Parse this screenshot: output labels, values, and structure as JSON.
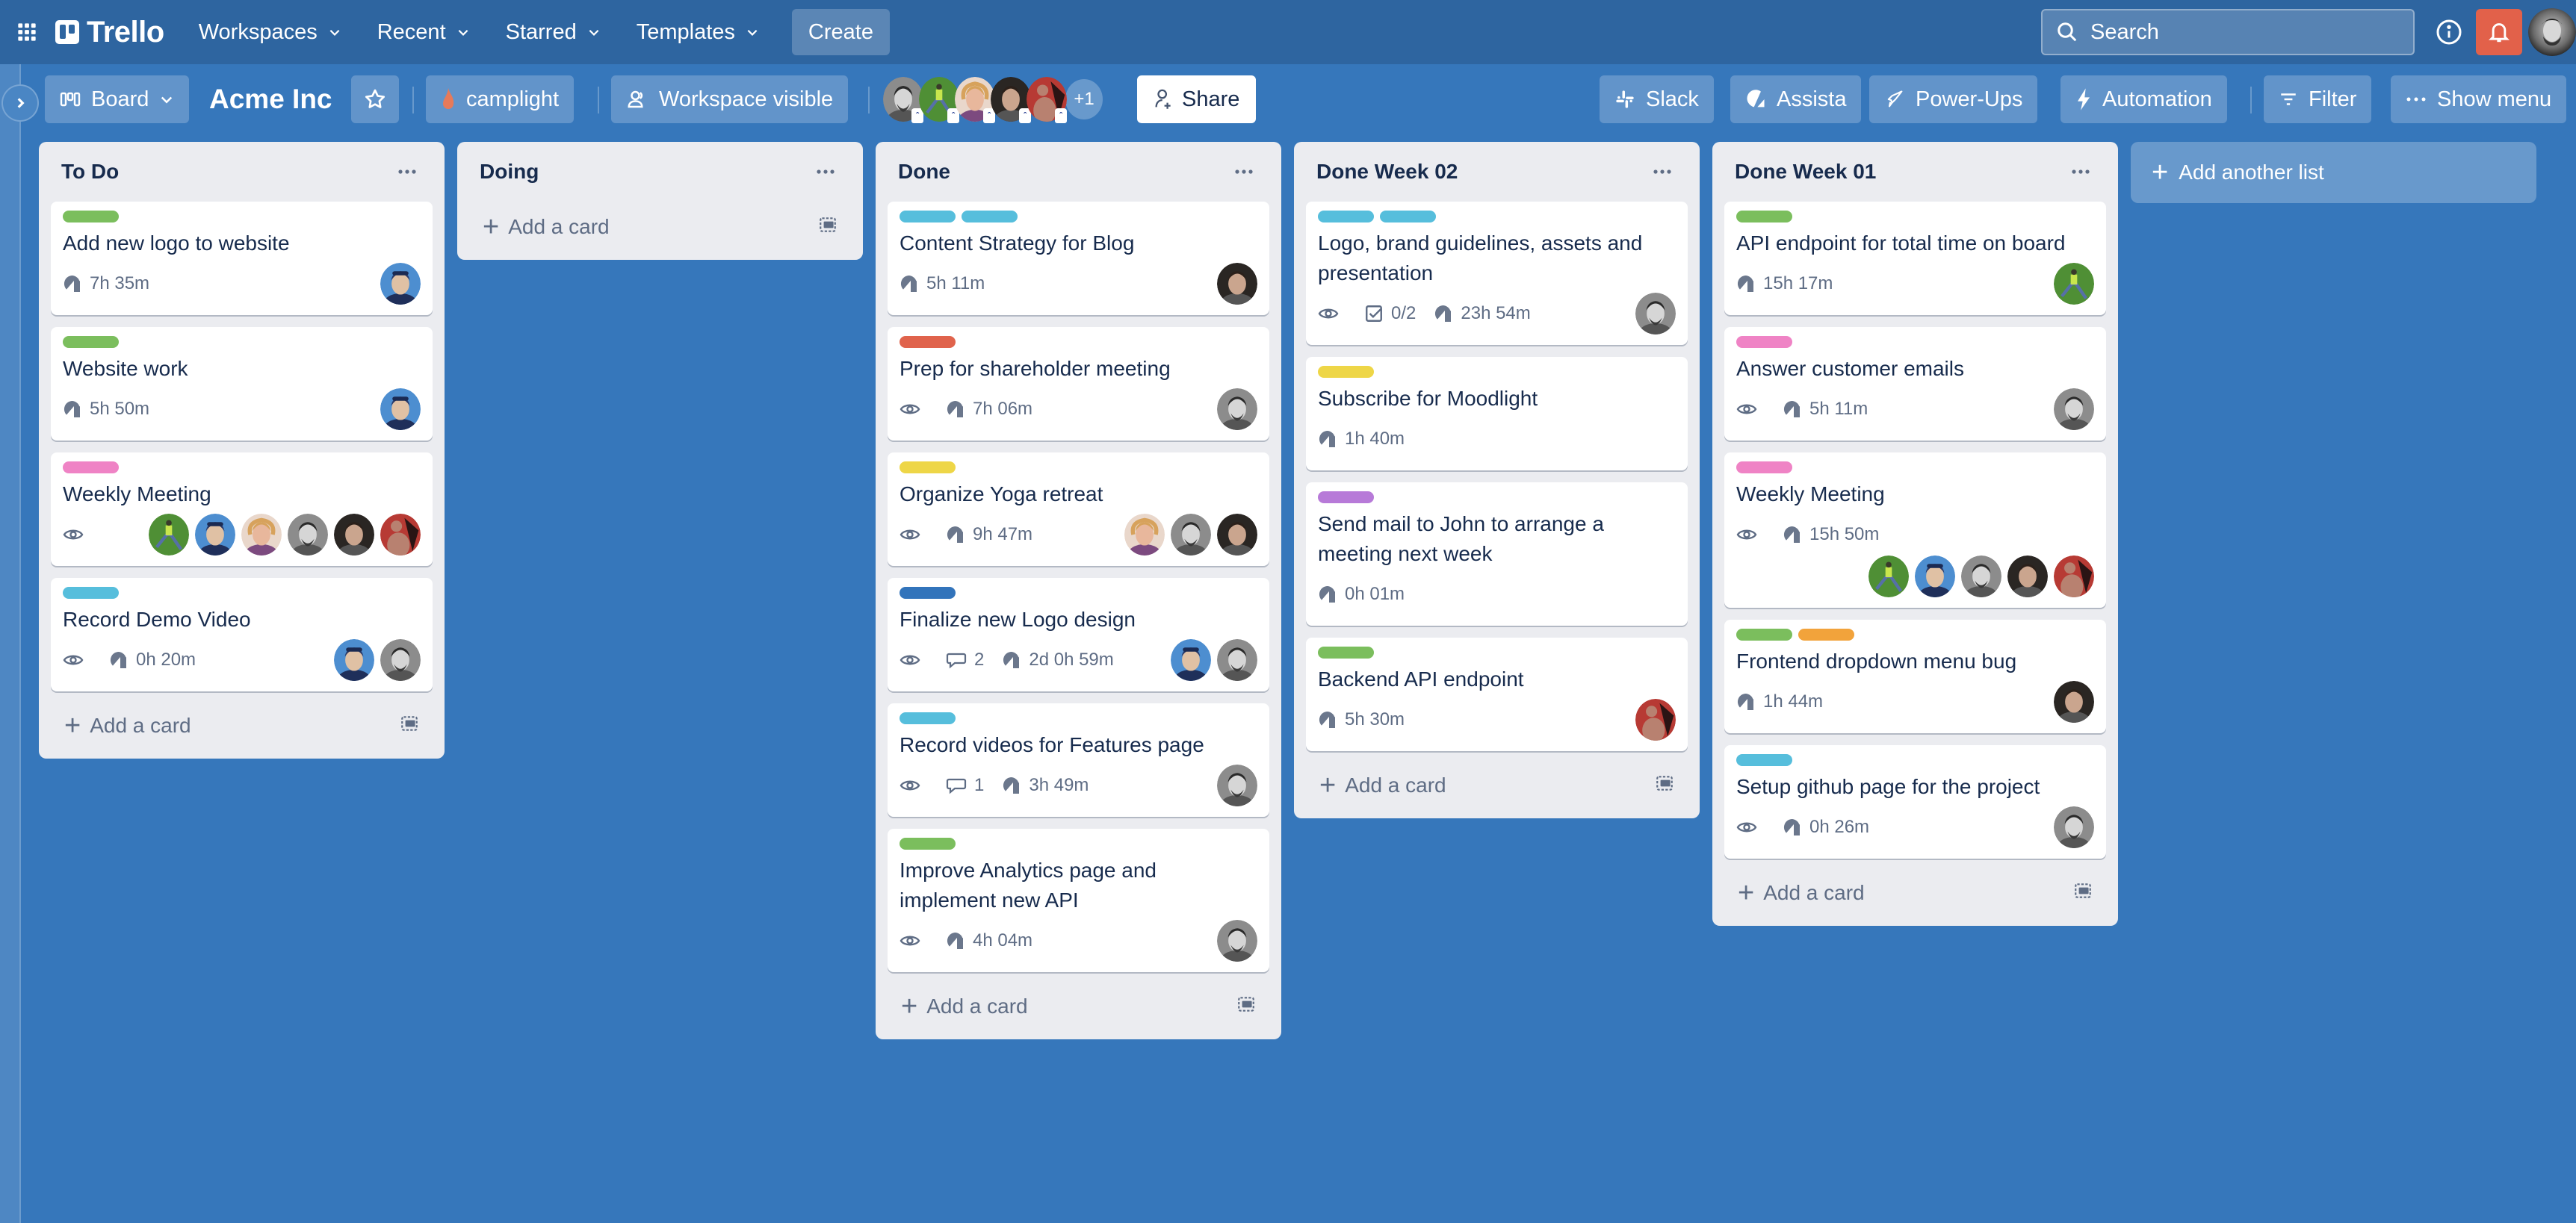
{
  "topnav": {
    "app_name": "Trello",
    "menus": [
      {
        "label": "Workspaces"
      },
      {
        "label": "Recent"
      },
      {
        "label": "Starred"
      },
      {
        "label": "Templates"
      }
    ],
    "create_label": "Create",
    "search_placeholder": "Search",
    "icons": {
      "apps": "apps-grid-icon",
      "info": "info-icon",
      "notifications": "bell-icon"
    },
    "colors": {
      "bar": "#2e65a0",
      "notification": "#e2614a"
    }
  },
  "boardbar": {
    "view_label": "Board",
    "board_title": "Acme Inc",
    "workspace_label": "camplight",
    "visibility_label": "Workspace visible",
    "members_extra": "+1",
    "share_label": "Share",
    "right_buttons": [
      {
        "label": "Slack",
        "icon": "slack-icon"
      },
      {
        "label": "Assista",
        "icon": "assista-icon"
      },
      {
        "label": "Power-Ups",
        "icon": "rocket-icon"
      },
      {
        "label": "Automation",
        "icon": "lightning-icon"
      },
      {
        "label": "Filter",
        "icon": "filter-icon"
      },
      {
        "label": "Show menu",
        "icon": "ellipsis-icon"
      }
    ]
  },
  "board": {
    "background": "#3677bb",
    "add_card_label": "Add a card",
    "add_list_label": "Add another list",
    "lists": [
      {
        "title": "To Do",
        "cards": [
          {
            "title": "Add new logo to website",
            "labels": [
              "#7bbe5d"
            ],
            "watch": false,
            "comments": null,
            "checklist": null,
            "time": "7h 35m",
            "members": [
              "blue"
            ]
          },
          {
            "title": "Website work",
            "labels": [
              "#7bbe5d"
            ],
            "watch": false,
            "comments": null,
            "checklist": null,
            "time": "5h 50m",
            "members": [
              "blue"
            ]
          },
          {
            "title": "Weekly Meeting",
            "labels": [
              "#ef83c5"
            ],
            "watch": true,
            "comments": null,
            "checklist": null,
            "time": null,
            "members": [
              "green",
              "blue",
              "blonde",
              "bw",
              "dark",
              "red"
            ]
          },
          {
            "title": "Record Demo Video",
            "labels": [
              "#56bedc"
            ],
            "watch": true,
            "comments": null,
            "checklist": null,
            "time": "0h 20m",
            "members": [
              "blue",
              "bw"
            ]
          }
        ]
      },
      {
        "title": "Doing",
        "cards": []
      },
      {
        "title": "Done",
        "cards": [
          {
            "title": "Content Strategy for Blog",
            "labels": [
              "#56bedc",
              "#56bedc"
            ],
            "watch": false,
            "comments": null,
            "checklist": null,
            "time": "5h 11m",
            "members": [
              "dark"
            ]
          },
          {
            "title": "Prep for shareholder meeting",
            "labels": [
              "#e0634c"
            ],
            "watch": true,
            "comments": null,
            "checklist": null,
            "time": "7h 06m",
            "members": [
              "bw"
            ]
          },
          {
            "title": "Organize Yoga retreat",
            "labels": [
              "#eed647"
            ],
            "watch": true,
            "comments": null,
            "checklist": null,
            "time": "9h 47m",
            "members": [
              "blonde",
              "bw",
              "dark"
            ]
          },
          {
            "title": "Finalize new Logo design",
            "labels": [
              "#3274bb"
            ],
            "watch": true,
            "comments": "2",
            "checklist": null,
            "time": "2d 0h 59m",
            "members": [
              "blue",
              "bw"
            ]
          },
          {
            "title": "Record videos for Features page",
            "labels": [
              "#56bedc"
            ],
            "watch": true,
            "comments": "1",
            "checklist": null,
            "time": "3h 49m",
            "members": [
              "bw"
            ]
          },
          {
            "title": "Improve Analytics page and implement new API",
            "labels": [
              "#7bbe5d"
            ],
            "watch": true,
            "comments": null,
            "checklist": null,
            "time": "4h 04m",
            "members": [
              "bw"
            ]
          }
        ]
      },
      {
        "title": "Done Week 02",
        "cards": [
          {
            "title": "Logo, brand guidelines, assets and presentation",
            "labels": [
              "#56bedc",
              "#56bedc"
            ],
            "watch": true,
            "comments": null,
            "checklist": "0/2",
            "time": "23h 54m",
            "members": [
              "bw"
            ]
          },
          {
            "title": "Subscribe for Moodlight",
            "labels": [
              "#eed647"
            ],
            "watch": false,
            "comments": null,
            "checklist": null,
            "time": "1h 40m",
            "members": []
          },
          {
            "title": "Send mail to John to arrange a meeting next week",
            "labels": [
              "#b77ad8"
            ],
            "watch": false,
            "comments": null,
            "checklist": null,
            "time": "0h 01m",
            "members": []
          },
          {
            "title": "Backend API endpoint",
            "labels": [
              "#7bbe5d"
            ],
            "watch": false,
            "comments": null,
            "checklist": null,
            "time": "5h 30m",
            "members": [
              "red"
            ]
          }
        ]
      },
      {
        "title": "Done Week 01",
        "cards": [
          {
            "title": "API endpoint for total time on board",
            "labels": [
              "#7bbe5d"
            ],
            "watch": false,
            "comments": null,
            "checklist": null,
            "time": "15h 17m",
            "members": [
              "green"
            ]
          },
          {
            "title": "Answer customer emails",
            "labels": [
              "#ef83c5"
            ],
            "watch": true,
            "comments": null,
            "checklist": null,
            "time": "5h 11m",
            "members": [
              "bw"
            ]
          },
          {
            "title": "Weekly Meeting",
            "labels": [
              "#ef83c5"
            ],
            "watch": true,
            "comments": null,
            "checklist": null,
            "time": "15h 50m",
            "members": [
              "green",
              "blue",
              "bw",
              "dark",
              "red"
            ],
            "members_wrap": true
          },
          {
            "title": "Frontend dropdown menu bug",
            "labels": [
              "#7bbe5d",
              "#f2a33b"
            ],
            "watch": false,
            "comments": null,
            "checklist": null,
            "time": "1h 44m",
            "members": [
              "dark"
            ]
          },
          {
            "title": "Setup github page for the project",
            "labels": [
              "#56bedc"
            ],
            "watch": true,
            "comments": null,
            "checklist": null,
            "time": "0h 26m",
            "members": [
              "bw"
            ]
          }
        ]
      }
    ]
  }
}
